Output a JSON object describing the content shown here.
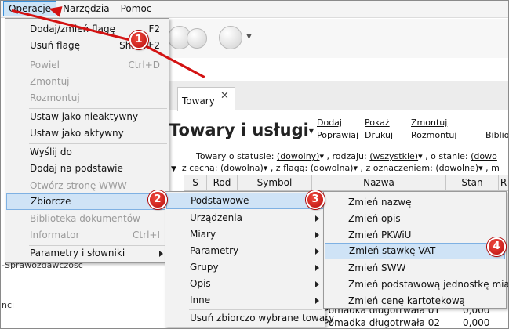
{
  "menubar": {
    "items": [
      "Operacje",
      "Narzędzia",
      "Pomoc"
    ]
  },
  "left_panel": {
    "labels": [
      "-Sprawozdawczość",
      "nci"
    ]
  },
  "tab": {
    "label": "Towary",
    "close": "✕"
  },
  "heading": {
    "title": "Towary i usługi",
    "caret": "▾"
  },
  "actions": [
    "Dodaj",
    "Poprawiaj",
    "Pokaż",
    "Drukuj",
    "Zmontuj",
    "Rozmontuj",
    "Bibliot"
  ],
  "filters": {
    "line1": [
      "Towary o statusie:",
      "(dowolny)",
      ", rodzaju:",
      "(wszystkie)",
      ", o stanie:",
      "(dowo"
    ],
    "line2": [
      "z cechą:",
      "(dowolna)",
      ", z flagą:",
      "(dowolna)",
      ", z oznaczeniem:",
      "(dowolne)",
      ", m"
    ]
  },
  "table": {
    "headers": [
      "S",
      "Rod",
      "Symbol",
      "Nazwa",
      "Stan",
      "R"
    ],
    "rows": [
      {
        "name": "Pomadka długotrwała 01",
        "stan": "0,000"
      },
      {
        "name": "Pomadka długotrwała 02",
        "stan": "0,000"
      }
    ]
  },
  "menu_operacje": {
    "items": [
      {
        "label": "Dodaj/zmień flagę",
        "shortcut": "F2",
        "disabled": false
      },
      {
        "label": "Usuń flagę",
        "shortcut": "Shift+F2",
        "disabled": false
      },
      {
        "label": "Powiel",
        "shortcut": "Ctrl+D",
        "disabled": true
      },
      {
        "label": "Zmontuj",
        "shortcut": "",
        "disabled": true
      },
      {
        "label": "Rozmontuj",
        "shortcut": "",
        "disabled": true
      },
      {
        "label": "Ustaw jako nieaktywny",
        "shortcut": "",
        "disabled": false
      },
      {
        "label": "Ustaw jako aktywny",
        "shortcut": "",
        "disabled": false
      },
      {
        "label": "Wyślij do",
        "shortcut": "",
        "disabled": false
      },
      {
        "label": "Dodaj na podstawie",
        "shortcut": "",
        "disabled": false
      },
      {
        "label": "Otwórz stronę WWW",
        "shortcut": "",
        "disabled": true
      },
      {
        "label": "Zbiorcze",
        "shortcut": "",
        "disabled": false
      },
      {
        "label": "Biblioteka dokumentów",
        "shortcut": "",
        "disabled": true
      },
      {
        "label": "Informator",
        "shortcut": "Ctrl+I",
        "disabled": true
      },
      {
        "label": "Parametry i słowniki",
        "shortcut": "",
        "disabled": false
      }
    ]
  },
  "menu_zbiorcze": {
    "items": [
      "Podstawowe",
      "Urządzenia",
      "Miary",
      "Parametry",
      "Grupy",
      "Opis",
      "Inne",
      "Usuń zbiorczo wybrane towary"
    ]
  },
  "menu_podstawowe": {
    "items": [
      "Zmień nazwę",
      "Zmień opis",
      "Zmień PKWiU",
      "Zmień stawkę VAT",
      "Zmień SWW",
      "Zmień podstawową jednostkę miary",
      "Zmień cenę kartotekową"
    ]
  },
  "badges": [
    "1",
    "2",
    "3",
    "4"
  ],
  "colors": {
    "highlight": "#cfe3f6",
    "badge": "#d31212",
    "menu_active": "#cce4f7"
  }
}
